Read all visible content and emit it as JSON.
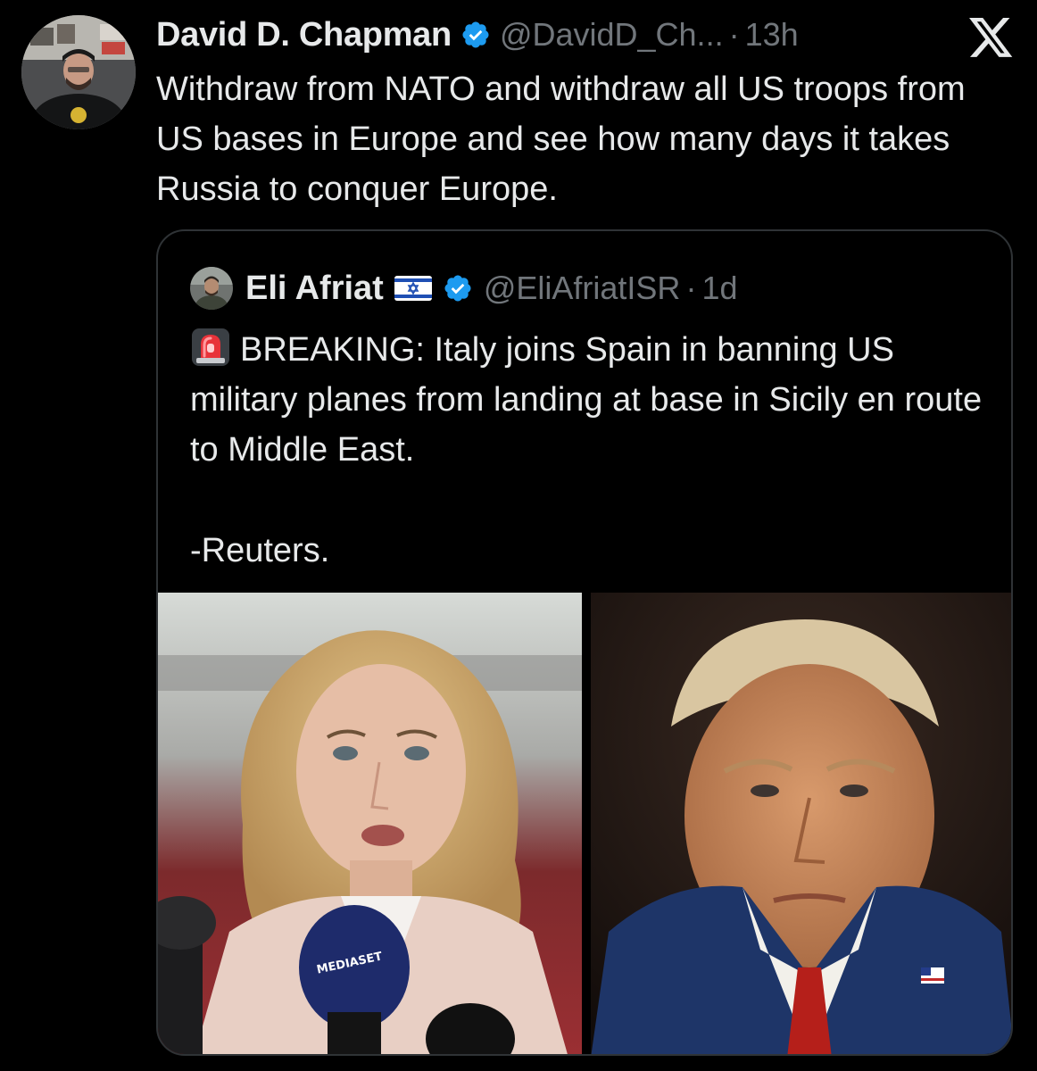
{
  "tweet": {
    "author": {
      "display_name": "David D. Chapman",
      "handle": "@DavidD_Ch...",
      "verified": true,
      "avatar_icon": "profile-photo"
    },
    "separator": "·",
    "time": "13h",
    "text": "Withdraw from NATO and withdraw all US troops from US bases in Europe and see how many days it takes Russia to conquer Europe.",
    "platform_icon": "x-logo-icon"
  },
  "quoted_tweet": {
    "author": {
      "display_name": "Eli Afriat",
      "flag_icon": "israel-flag-icon",
      "handle": "@EliAfriatISR",
      "verified": true
    },
    "separator": "·",
    "time": "1d",
    "emoji_icon": "police-siren-icon",
    "text": "BREAKING: Italy joins Spain in banning US military planes from landing at base in Sicily en route to Middle East.",
    "signature": "-Reuters.",
    "media": [
      {
        "name": "woman-at-microphones-photo",
        "mic_label": "MEDIASET"
      },
      {
        "name": "man-in-suit-portrait-photo"
      }
    ]
  },
  "colors": {
    "background": "#000000",
    "text_primary": "#e7e9ea",
    "text_secondary": "#71767b",
    "verified_blue": "#1d9bf0",
    "card_border": "#2f3336"
  }
}
